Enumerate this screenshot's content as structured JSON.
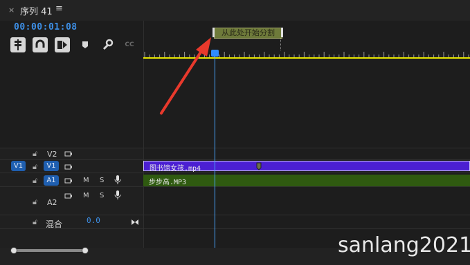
{
  "window": {
    "close": "×",
    "title": "序列 41",
    "menu": "≡"
  },
  "timecode": "00:00:01:08",
  "toolbar": {
    "tools": [
      "snap-tool",
      "magnet-tool",
      "linked-selection-tool",
      "marker-tool",
      "wrench-tool",
      "captions-tool"
    ],
    "cc_label": "CC"
  },
  "marker": {
    "label": "从此处开始分割"
  },
  "tracks": {
    "v2": {
      "name": "V2"
    },
    "v1": {
      "source": "V1",
      "name": "V1"
    },
    "a1": {
      "name": "A1",
      "m": "M",
      "s": "S"
    },
    "a2": {
      "name": "A2",
      "m": "M",
      "s": "S"
    },
    "mix": {
      "name": "混合",
      "value": "0.0"
    }
  },
  "clips": {
    "video": "图书馆女孩.mp4",
    "audio": "步步高.MP3"
  },
  "watermark": "sanlang2021",
  "colors": {
    "accent": "#3d8fe6",
    "video_clip": "#4b1fd2",
    "audio_clip": "#2f5a10",
    "work_area": "#e6e600",
    "arrow": "#e8392c"
  }
}
